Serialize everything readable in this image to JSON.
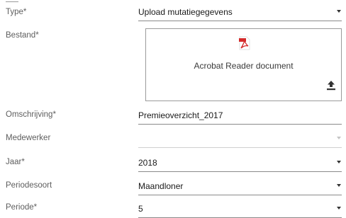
{
  "form": {
    "type": {
      "label": "Type*",
      "value": "Upload mutatiegegevens"
    },
    "file": {
      "label": "Bestand*",
      "file_name": "Acrobat Reader document",
      "file_icon": "pdf-icon",
      "action_icon": "upload-icon"
    },
    "description": {
      "label": "Omschrijving*",
      "value": "Premieoverzicht_2017"
    },
    "employee": {
      "label": "Medewerker",
      "value": ""
    },
    "year": {
      "label": "Jaar*",
      "value": "2018"
    },
    "period_type": {
      "label": "Periodesoort",
      "value": "Maandloner"
    },
    "period": {
      "label": "Periode*",
      "value": "5"
    }
  },
  "colors": {
    "pdf_red": "#d42a2a",
    "underline": "#8a8a8a",
    "label_text": "#5e5e5e"
  }
}
